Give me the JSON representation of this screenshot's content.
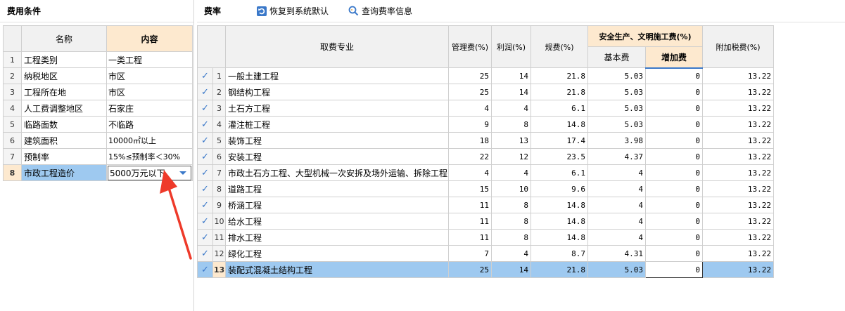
{
  "left": {
    "title": "费用条件",
    "headers": {
      "name": "名称",
      "content": "内容"
    },
    "rows": [
      {
        "no": "1",
        "name": "工程类别",
        "value": "一类工程"
      },
      {
        "no": "2",
        "name": "纳税地区",
        "value": "市区"
      },
      {
        "no": "3",
        "name": "工程所在地",
        "value": "市区"
      },
      {
        "no": "4",
        "name": "人工费调整地区",
        "value": "石家庄"
      },
      {
        "no": "5",
        "name": "临路面数",
        "value": "不临路"
      },
      {
        "no": "6",
        "name": "建筑面积",
        "value": "10000㎡以上"
      },
      {
        "no": "7",
        "name": "预制率",
        "value": "15%≤预制率＜30%"
      },
      {
        "no": "8",
        "name": "市政工程造价",
        "value": "5000万元以下"
      }
    ]
  },
  "right": {
    "title": "费率",
    "toolbar": {
      "restore": "恢复到系统默认",
      "query": "查询费率信息"
    },
    "headers": {
      "specialty": "取费专业",
      "mgmt": "管理费(%)",
      "profit": "利润(%)",
      "regfee": "规费(%)",
      "safety": "安全生产、文明施工费(%)",
      "basic": "基本费",
      "increase": "增加费",
      "tax": "附加税费(%)"
    },
    "rows": [
      {
        "no": "1",
        "name": "一般土建工程",
        "mgmt": "25",
        "profit": "14",
        "reg": "21.8",
        "basic": "5.03",
        "inc": "0",
        "tax": "13.22"
      },
      {
        "no": "2",
        "name": "钢结构工程",
        "mgmt": "25",
        "profit": "14",
        "reg": "21.8",
        "basic": "5.03",
        "inc": "0",
        "tax": "13.22"
      },
      {
        "no": "3",
        "name": "土石方工程",
        "mgmt": "4",
        "profit": "4",
        "reg": "6.1",
        "basic": "5.03",
        "inc": "0",
        "tax": "13.22"
      },
      {
        "no": "4",
        "name": "灌注桩工程",
        "mgmt": "9",
        "profit": "8",
        "reg": "14.8",
        "basic": "5.03",
        "inc": "0",
        "tax": "13.22"
      },
      {
        "no": "5",
        "name": "装饰工程",
        "mgmt": "18",
        "profit": "13",
        "reg": "17.4",
        "basic": "3.98",
        "inc": "0",
        "tax": "13.22"
      },
      {
        "no": "6",
        "name": "安装工程",
        "mgmt": "22",
        "profit": "12",
        "reg": "23.5",
        "basic": "4.37",
        "inc": "0",
        "tax": "13.22"
      },
      {
        "no": "7",
        "name": "市政土石方工程、大型机械一次安拆及场外运输、拆除工程",
        "mgmt": "4",
        "profit": "4",
        "reg": "6.1",
        "basic": "4",
        "inc": "0",
        "tax": "13.22"
      },
      {
        "no": "8",
        "name": "道路工程",
        "mgmt": "15",
        "profit": "10",
        "reg": "9.6",
        "basic": "4",
        "inc": "0",
        "tax": "13.22"
      },
      {
        "no": "9",
        "name": "桥涵工程",
        "mgmt": "11",
        "profit": "8",
        "reg": "14.8",
        "basic": "4",
        "inc": "0",
        "tax": "13.22"
      },
      {
        "no": "10",
        "name": "给水工程",
        "mgmt": "11",
        "profit": "8",
        "reg": "14.8",
        "basic": "4",
        "inc": "0",
        "tax": "13.22"
      },
      {
        "no": "11",
        "name": "排水工程",
        "mgmt": "11",
        "profit": "8",
        "reg": "14.8",
        "basic": "4",
        "inc": "0",
        "tax": "13.22"
      },
      {
        "no": "12",
        "name": "绿化工程",
        "mgmt": "7",
        "profit": "4",
        "reg": "8.7",
        "basic": "4.31",
        "inc": "0",
        "tax": "13.22"
      },
      {
        "no": "13",
        "name": "装配式混凝土结构工程",
        "mgmt": "25",
        "profit": "14",
        "reg": "21.8",
        "basic": "5.03",
        "inc": "0",
        "tax": "13.22"
      }
    ]
  },
  "colors": {
    "accent": "#3a78c9",
    "highlight": "#fde9cf",
    "selected": "#9ec9f0",
    "annotation": "#ee3a2a"
  }
}
